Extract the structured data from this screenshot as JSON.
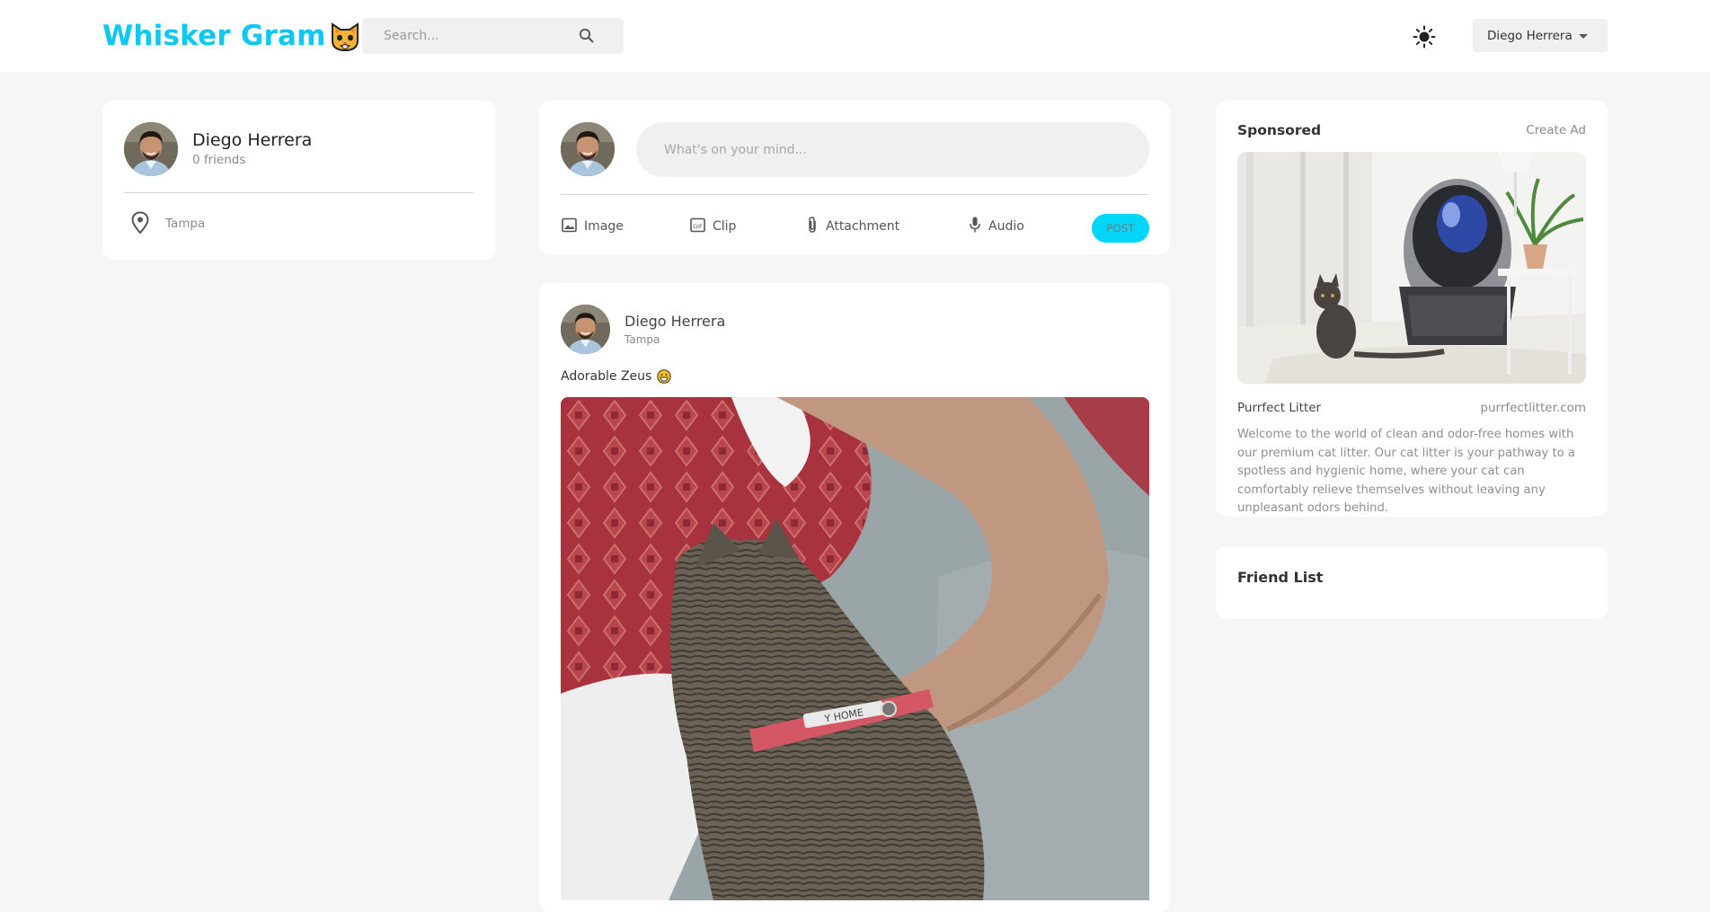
{
  "brand": {
    "name": "Whisker Gram",
    "accent": "#10c8ef",
    "icon": "cat-face-icon"
  },
  "search": {
    "placeholder": "Search..."
  },
  "header": {
    "theme_icon": "sun-icon",
    "user_select_value": "Diego Herrera"
  },
  "profile": {
    "name": "Diego Herrera",
    "friends": "0 friends",
    "location": "Tampa"
  },
  "composer": {
    "placeholder": "What's on your mind...",
    "actions": [
      {
        "label": "Image",
        "icon": "image-icon"
      },
      {
        "label": "Clip",
        "icon": "clip-icon"
      },
      {
        "label": "Attachment",
        "icon": "paperclip-icon"
      },
      {
        "label": "Audio",
        "icon": "microphone-icon"
      }
    ],
    "post_label": "POST",
    "post_color": "#00d5fa"
  },
  "post": {
    "author": "Diego Herrera",
    "location": "Tampa",
    "caption": "Adorable Zeus"
  },
  "sponsored": {
    "title": "Sponsored",
    "create_ad": "Create Ad",
    "brand": "Purrfect Litter",
    "url": "purrfectlitter.com",
    "description": "Welcome to the world of clean and odor-free homes with our premium cat litter. Our cat litter is your pathway to a spotless and hygienic home, where your cat can comfortably relieve themselves without leaving any unpleasant odors behind."
  },
  "friends": {
    "title": "Friend List"
  }
}
